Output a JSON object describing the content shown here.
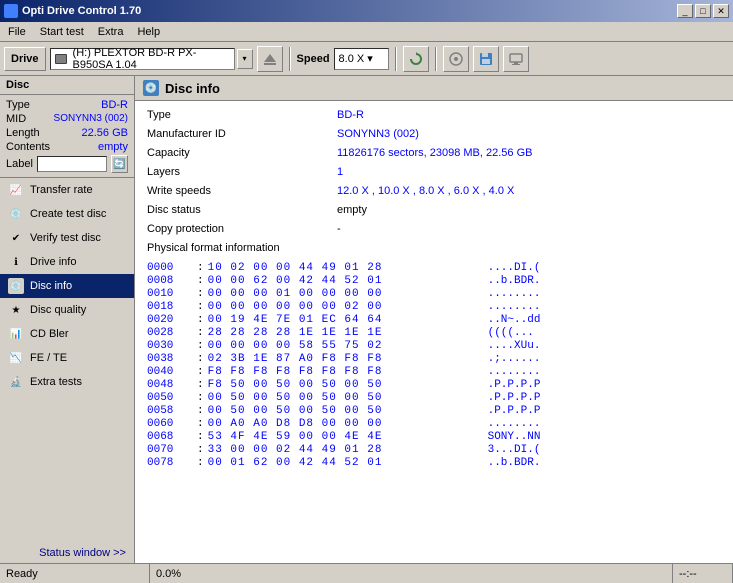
{
  "window": {
    "title": "Opti Drive Control 1.70",
    "controls": {
      "minimize": "_",
      "maximize": "□",
      "close": "✕"
    }
  },
  "menu": {
    "items": [
      "File",
      "Start test",
      "Extra",
      "Help"
    ]
  },
  "toolbar": {
    "drive_label": "Drive",
    "drive_value": "(H:)  PLEXTOR BD-R  PX-B950SA 1.04",
    "speed_label": "Speed",
    "speed_value": "8.0 X ▾"
  },
  "sidebar": {
    "section_disc": "Disc",
    "disc_type_label": "Type",
    "disc_type_value": "BD-R",
    "disc_mid_label": "MID",
    "disc_mid_value": "SONYNN3 (002)",
    "disc_length_label": "Length",
    "disc_length_value": "22.56 GB",
    "disc_contents_label": "Contents",
    "disc_contents_value": "empty",
    "disc_label_label": "Label",
    "disc_label_value": "",
    "nav_items": [
      {
        "id": "transfer-rate",
        "label": "Transfer rate",
        "icon": "📈"
      },
      {
        "id": "create-test-disc",
        "label": "Create test disc",
        "icon": "💿"
      },
      {
        "id": "verify-test-disc",
        "label": "Verify test disc",
        "icon": "✔"
      },
      {
        "id": "drive-info",
        "label": "Drive info",
        "icon": "ℹ"
      },
      {
        "id": "disc-info",
        "label": "Disc info",
        "icon": "💿",
        "active": true
      },
      {
        "id": "disc-quality",
        "label": "Disc quality",
        "icon": "★"
      },
      {
        "id": "cd-bler",
        "label": "CD Bler",
        "icon": "📊"
      },
      {
        "id": "fe-te",
        "label": "FE / TE",
        "icon": "📉"
      },
      {
        "id": "extra-tests",
        "label": "Extra tests",
        "icon": "🔬"
      }
    ],
    "status_window_btn": "Status window >>"
  },
  "panel": {
    "title": "Disc info",
    "icon": "💿",
    "rows": [
      {
        "label": "Type",
        "value": "BD-R"
      },
      {
        "label": "Manufacturer ID",
        "value": "SONYNN3 (002)"
      },
      {
        "label": "Capacity",
        "value": "11826176 sectors, 23098 MB, 22.56 GB"
      },
      {
        "label": "Layers",
        "value": "1"
      },
      {
        "label": "Write speeds",
        "value": "12.0 X , 10.0 X , 8.0 X , 6.0 X , 4.0 X"
      },
      {
        "label": "Disc status",
        "value": "empty"
      },
      {
        "label": "Copy protection",
        "value": "-"
      },
      {
        "label": "Physical format information",
        "value": ""
      }
    ],
    "hex_data": [
      {
        "addr": "0000",
        "bytes": "10 02 00 00 44 49 01 28",
        "ascii": "....DI.("
      },
      {
        "addr": "0008",
        "bytes": "00 00 62 00 42 44 52 01",
        "ascii": "..b.BDR."
      },
      {
        "addr": "0010",
        "bytes": "00 00 00 01 00 00 00 00",
        "ascii": "........"
      },
      {
        "addr": "0018",
        "bytes": "00 00 00 00 00 00 02 00",
        "ascii": "........"
      },
      {
        "addr": "0020",
        "bytes": "00 19 4E 7E 01 EC 64 64",
        "ascii": "..N~..dd"
      },
      {
        "addr": "0028",
        "bytes": "28 28 28 28 1E 1E 1E 1E",
        "ascii": "((((..."
      },
      {
        "addr": "0030",
        "bytes": "00 00 00 00 58 55 75 02",
        "ascii": "....XUu."
      },
      {
        "addr": "0038",
        "bytes": "02 3B 1E 87 A0 F8 F8 F8",
        "ascii": ".;......"
      },
      {
        "addr": "0040",
        "bytes": "F8 F8 F8 F8 F8 F8 F8 F8",
        "ascii": "........"
      },
      {
        "addr": "0048",
        "bytes": "F8 50 00 50 00 50 00 50",
        "ascii": ".P.P.P.P"
      },
      {
        "addr": "0050",
        "bytes": "00 50 00 50 00 50 00 50",
        "ascii": ".P.P.P.P"
      },
      {
        "addr": "0058",
        "bytes": "00 50 00 50 00 50 00 50",
        "ascii": ".P.P.P.P"
      },
      {
        "addr": "0060",
        "bytes": "00 A0 A0 D8 D8 00 00 00",
        "ascii": "........"
      },
      {
        "addr": "0068",
        "bytes": "53 4F 4E 59 00 00 4E 4E",
        "ascii": "SONY..NN"
      },
      {
        "addr": "0070",
        "bytes": "33 00 00 02 44 49 01 28",
        "ascii": "3...DI.("
      },
      {
        "addr": "0078",
        "bytes": "00 01 62 00 42 44 52 01",
        "ascii": "..b.BDR."
      }
    ]
  },
  "statusbar": {
    "status": "Ready",
    "progress": "0.0%",
    "time": "--:--"
  }
}
